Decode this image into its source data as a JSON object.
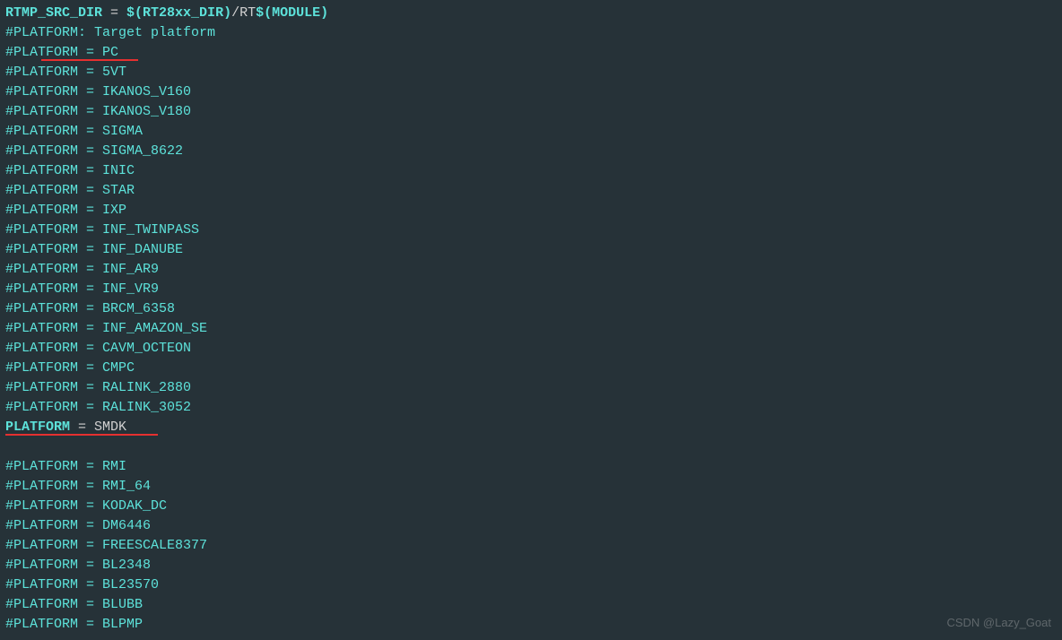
{
  "line1": {
    "p1": "RTMP_SRC_DIR",
    "p2": " = ",
    "p3": "$(RT28xx_DIR)",
    "p4": "/RT",
    "p5": "$(MODULE)"
  },
  "blank": "",
  "comment_header": "#PLATFORM: Target platform",
  "lines": [
    "#PLATFORM = PC",
    "#PLATFORM = 5VT",
    "#PLATFORM = IKANOS_V160",
    "#PLATFORM = IKANOS_V180",
    "#PLATFORM = SIGMA",
    "#PLATFORM = SIGMA_8622",
    "#PLATFORM = INIC",
    "#PLATFORM = STAR",
    "#PLATFORM = IXP",
    "#PLATFORM = INF_TWINPASS",
    "#PLATFORM = INF_DANUBE",
    "#PLATFORM = INF_AR9",
    "#PLATFORM = INF_VR9",
    "#PLATFORM = BRCM_6358",
    "#PLATFORM = INF_AMAZON_SE",
    "#PLATFORM = CAVM_OCTEON",
    "#PLATFORM = CMPC",
    "#PLATFORM = RALINK_2880",
    "#PLATFORM = RALINK_3052"
  ],
  "active": {
    "p1": "PLATFORM",
    "p2": " = SMDK"
  },
  "lines2": [
    "#PLATFORM = RMI",
    "#PLATFORM = RMI_64",
    "#PLATFORM = KODAK_DC",
    "#PLATFORM = DM6446",
    "#PLATFORM = FREESCALE8377",
    "#PLATFORM = BL2348",
    "#PLATFORM = BL23570",
    "#PLATFORM = BLUBB",
    "#PLATFORM = BLPMP"
  ],
  "watermark": "CSDN @Lazy_Goat"
}
